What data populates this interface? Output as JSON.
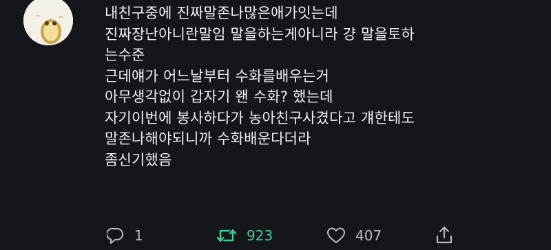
{
  "tweet": {
    "lines": [
      "내친구중에 진짜말존나많은애가잇는데",
      "진짜장난아니란말임 말을하는게아니라 걍 말을토하",
      "는수준",
      "근데얘가 어느날부터 수화를배우는거",
      "아무생각없이 갑자기 왠 수화? 했는데",
      "자기이번에 봉사하다가 농아친구사겼다고 걔한테도",
      "말존나해야되니까 수화배운다더라",
      "좀신기했음"
    ]
  },
  "actions": {
    "reply": {
      "icon": "reply-icon",
      "count": "1"
    },
    "retweet": {
      "icon": "retweet-icon",
      "count": "923",
      "color": "#3fcf8e"
    },
    "like": {
      "icon": "heart-icon",
      "count": "407"
    },
    "share": {
      "icon": "share-icon"
    }
  },
  "colors": {
    "background": "#15161b",
    "text": "#eef0f3",
    "muted": "#b9bcc4",
    "retweet_active": "#3fcf8e"
  }
}
